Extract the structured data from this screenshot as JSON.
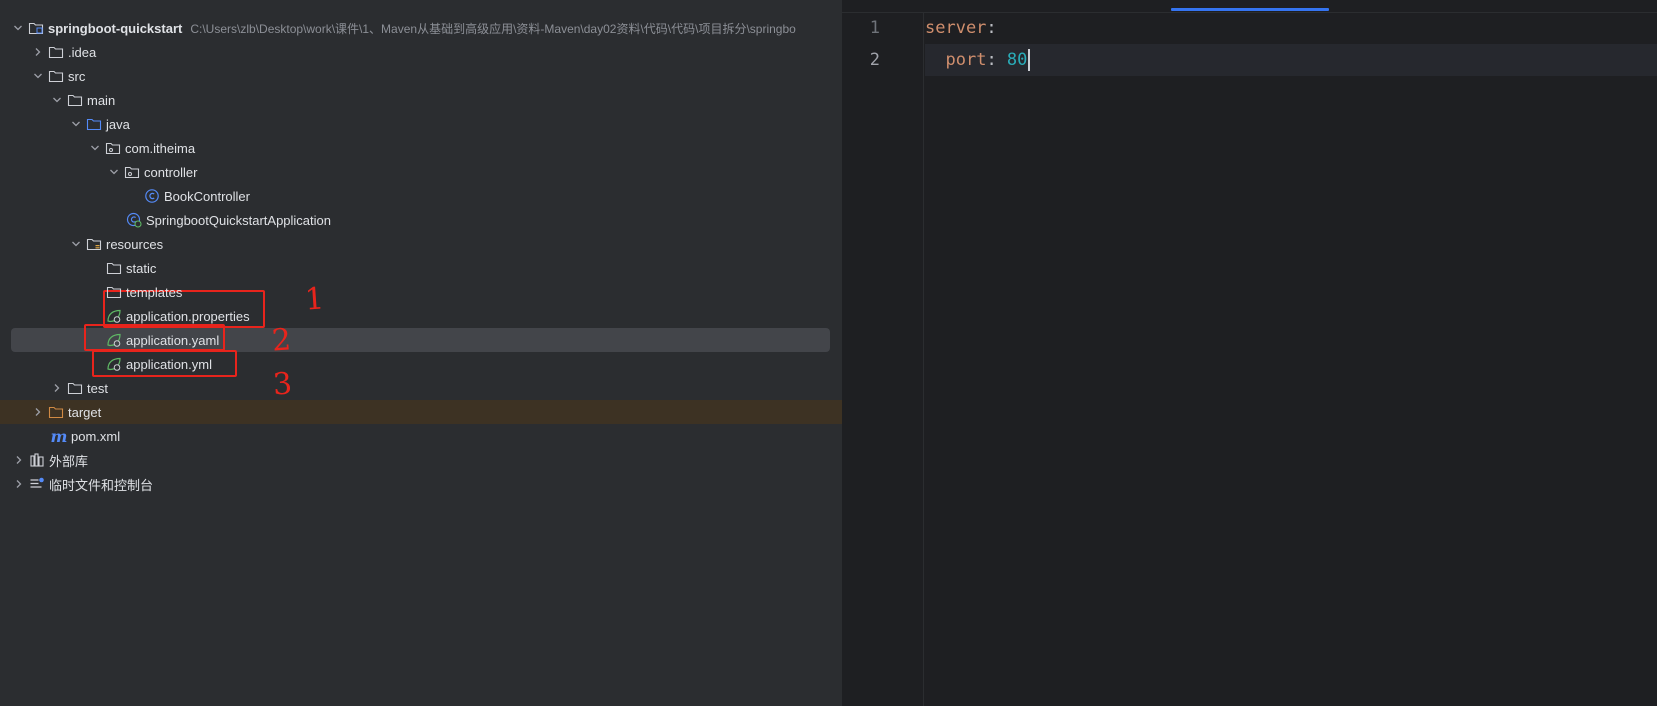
{
  "tree": {
    "project_name": "springboot-quickstart",
    "project_path": "C:\\Users\\zlb\\Desktop\\work\\课件\\1、Maven从基础到高级应用\\资料-Maven\\day02资料\\代码\\代码\\项目拆分\\springbo",
    "items": {
      "idea": ".idea",
      "src": "src",
      "main": "main",
      "java": "java",
      "package": "com.itheima",
      "controller": "controller",
      "book_controller": "BookController",
      "app_class": "SpringbootQuickstartApplication",
      "resources": "resources",
      "static": "static",
      "templates": "templates",
      "app_properties": "application.properties",
      "app_yaml": "application.yaml",
      "app_yml": "application.yml",
      "test": "test",
      "target": "target",
      "pom": "pom.xml",
      "external_libs": "外部库",
      "scratches": "临时文件和控制台"
    },
    "selected_item": "application.yaml"
  },
  "annotations": {
    "labels": [
      "1",
      "2",
      "3"
    ],
    "color": "#e8241c"
  },
  "editor": {
    "line_numbers": [
      "1",
      "2"
    ],
    "current_line": "2",
    "line1": {
      "key": "server",
      "colon": ":"
    },
    "line2": {
      "indent": "  ",
      "key": "port",
      "colon": ": ",
      "value": "80"
    }
  },
  "colors": {
    "tree_bg": "#2b2d30",
    "editor_bg": "#1e1f22",
    "selection": "#43454a",
    "excluded_folder": "#3d3223",
    "yaml_key": "#cf8e6d",
    "yaml_number": "#2aacb8",
    "accent": "#3574f0"
  }
}
